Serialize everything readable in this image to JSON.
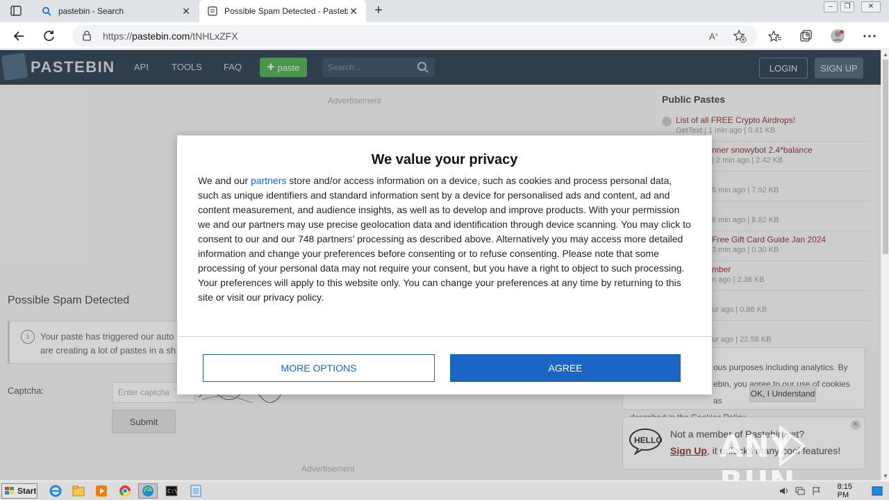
{
  "browser": {
    "tabs": [
      {
        "title": "pastebin - Search",
        "icon": "search-icon"
      },
      {
        "title": "Possible Spam Detected - Pastebin.com",
        "icon": "pastebin-favicon"
      }
    ],
    "url_prefix": "https://",
    "url_host": "pastebin.com",
    "url_path": "/tNHLxZFX"
  },
  "site": {
    "brand": "PASTEBIN",
    "nav": [
      "API",
      "TOOLS",
      "FAQ"
    ],
    "paste_label": "paste",
    "search_placeholder": "Search...",
    "login": "LOGIN",
    "signup": "SIGN UP"
  },
  "main": {
    "ad_top": "Advertisement",
    "title": "Possible Spam Detected",
    "notice_line1": "Your paste has triggered our auto",
    "notice_line2": "are creating a lot of pastes in a sh",
    "captcha_label": "Captcha:",
    "captcha_placeholder": "Enter captcha",
    "submit": "Submit",
    "ad_bottom": "Advertisement"
  },
  "sidebar": {
    "title": "Public Pastes",
    "pastes": [
      {
        "title": "List of all FREE Crypto Airdrops!",
        "meta": "GetText | 1 min ago | 0.41 KB"
      },
      {
        "title": "nner snowybot 2.4*balance",
        "meta": "| 2 min ago | 2.42 KB"
      },
      {
        "title": "",
        "meta": "5 min ago | 7.92 KB"
      },
      {
        "title": "",
        "meta": "6 min ago | 8.82 KB"
      },
      {
        "title": "Free Gift Card Guide Jan 2024",
        "meta": "3 min ago | 0.30 KB"
      },
      {
        "title": "mber",
        "meta": "n ago | 2.36 KB"
      },
      {
        "title": "",
        "meta": "ur ago | 0.88 KB"
      },
      {
        "title": "",
        "meta": "ur ago | 22.58 KB"
      }
    ]
  },
  "cookie_card": {
    "line1": "ous purposes including analytics. By",
    "line2": "ebin, you agree to our use of cookies as",
    "line3": "described in the Cookies Policy.",
    "ok": "OK, I Understand"
  },
  "member_card": {
    "line1": "Not a member of Pastebin yet?",
    "signup": "Sign Up",
    "line2_rest": ", it unlocks many cool features!"
  },
  "watermark": "ANY RUN",
  "consent": {
    "title": "We value your privacy",
    "body_pre": "We and our ",
    "partners_link": "partners",
    "body_post": " store and/or access information on a device, such as cookies and process personal data, such as unique identifiers and standard information sent by a device for personalised ads and content, ad and content measurement, and audience insights, as well as to develop and improve products. With your permission we and our partners may use precise geolocation data and identification through device scanning. You may click to consent to our and our 748 partners’ processing as described above. Alternatively you may access more detailed information and change your preferences before consenting or to refuse consenting. Please note that some processing of your personal data may not require your consent, but you have a right to object to such processing. Your preferences will apply to this website only. You can change your preferences at any time by returning to this site or visit our privacy policy.",
    "more_options": "MORE OPTIONS",
    "agree": "AGREE"
  },
  "taskbar": {
    "start": "Start",
    "clock": "8:15 PM"
  },
  "colors": {
    "header_bg": "#2d3f50",
    "accent_blue": "#1a66c2",
    "paste_green": "#4caf50",
    "link_red": "#8b2f2f"
  }
}
